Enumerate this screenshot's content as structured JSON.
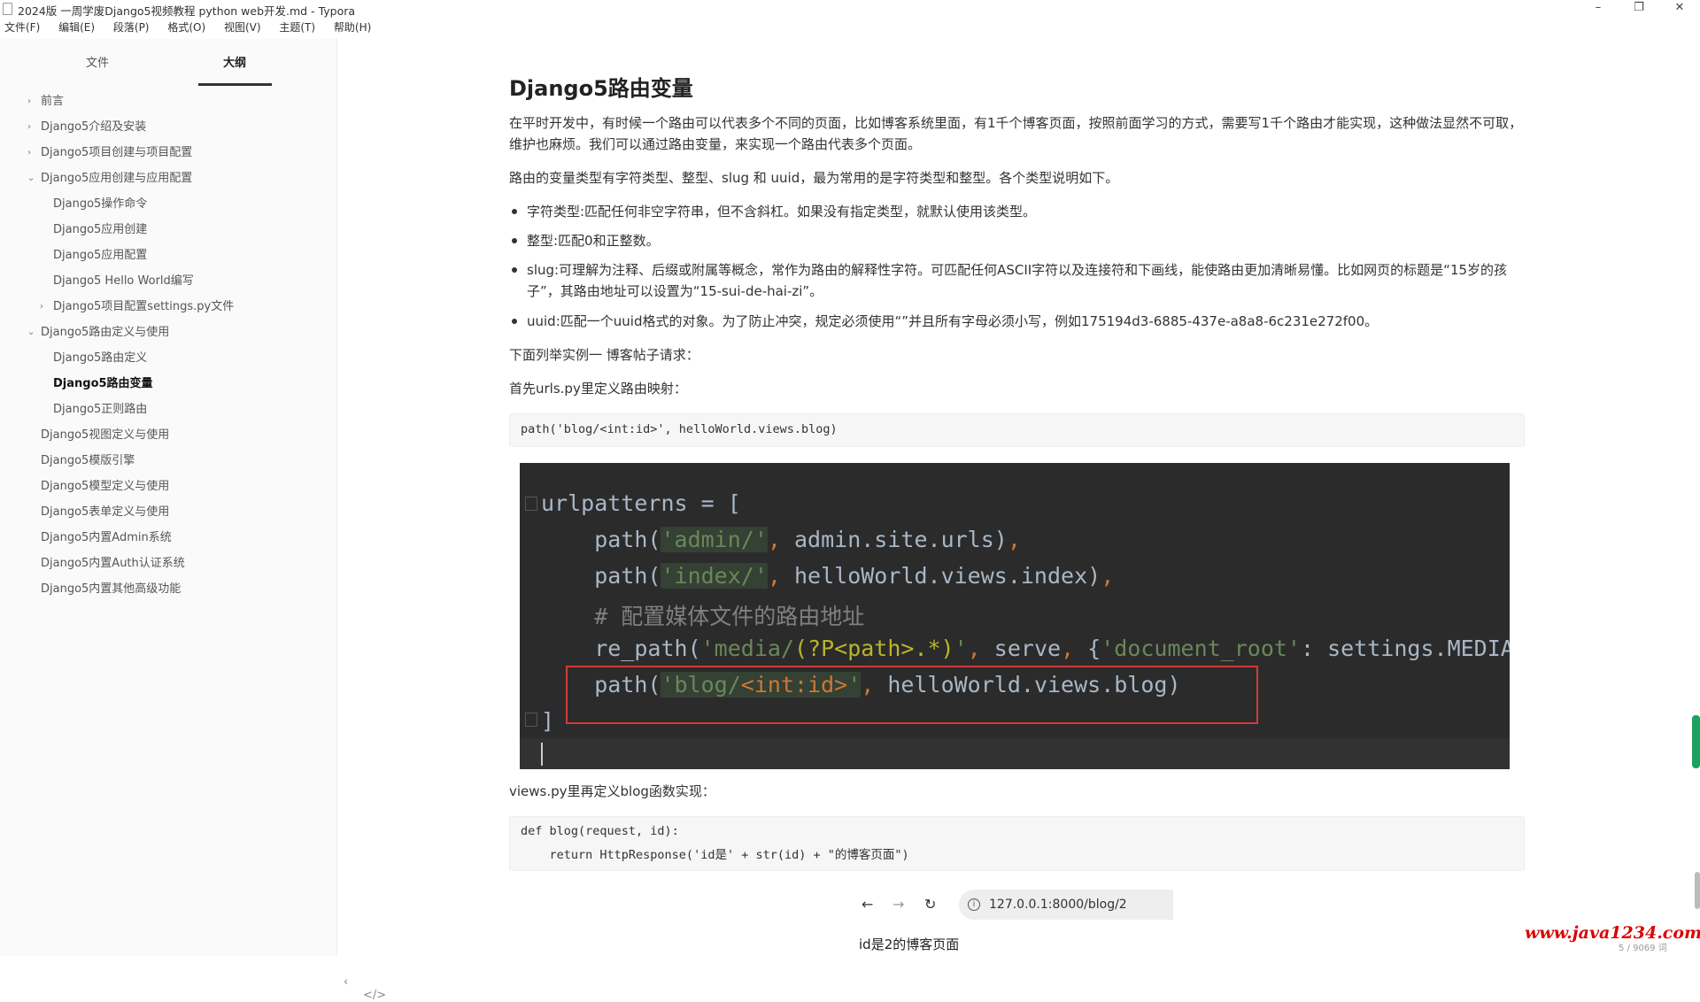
{
  "window": {
    "title": "2024版 一周学废Django5视频教程 python web开发.md - Typora",
    "controls": {
      "minimize": "–",
      "maximize": "❐",
      "close": "✕"
    }
  },
  "menu": [
    "文件(F)",
    "编辑(E)",
    "段落(P)",
    "格式(O)",
    "视图(V)",
    "主题(T)",
    "帮助(H)"
  ],
  "sidebar": {
    "tabs": {
      "files": "文件",
      "outline": "大纲"
    },
    "outline": [
      {
        "label": "前言",
        "level": 1,
        "toggle": "›"
      },
      {
        "label": "Django5介绍及安装",
        "level": 1,
        "toggle": "›"
      },
      {
        "label": "Django5项目创建与项目配置",
        "level": 1,
        "toggle": "›"
      },
      {
        "label": "Django5应用创建与应用配置",
        "level": 1,
        "toggle": "⌄"
      },
      {
        "label": "Django5操作命令",
        "level": 2,
        "toggle": ""
      },
      {
        "label": "Django5应用创建",
        "level": 2,
        "toggle": ""
      },
      {
        "label": "Django5应用配置",
        "level": 2,
        "toggle": ""
      },
      {
        "label": "Django5 Hello World编写",
        "level": 2,
        "toggle": ""
      },
      {
        "label": "Django5项目配置settings.py文件",
        "level": 2,
        "toggle": "›"
      },
      {
        "label": "Django5路由定义与使用",
        "level": 1,
        "toggle": "⌄"
      },
      {
        "label": "Django5路由定义",
        "level": 2,
        "toggle": ""
      },
      {
        "label": "Django5路由变量",
        "level": 2,
        "toggle": "",
        "active": true
      },
      {
        "label": "Django5正则路由",
        "level": 2,
        "toggle": ""
      },
      {
        "label": "Django5视图定义与使用",
        "level": 1,
        "toggle": ""
      },
      {
        "label": "Django5模版引擎",
        "level": 1,
        "toggle": ""
      },
      {
        "label": "Django5模型定义与使用",
        "level": 1,
        "toggle": ""
      },
      {
        "label": "Django5表单定义与使用",
        "level": 1,
        "toggle": ""
      },
      {
        "label": "Django5内置Admin系统",
        "level": 1,
        "toggle": ""
      },
      {
        "label": "Django5内置Auth认证系统",
        "level": 1,
        "toggle": ""
      },
      {
        "label": "Django5内置其他高级功能",
        "level": 1,
        "toggle": ""
      }
    ],
    "bottom_icons": {
      "collapse": "‹",
      "source": "</>"
    }
  },
  "content": {
    "heading": "Django5路由变量",
    "intro": "在平时开发中，有时候一个路由可以代表多个不同的页面，比如博客系统里面，有1千个博客页面，按照前面学习的方式，需要写1千个路由才能实现，这种做法显然不可取，维护也麻烦。我们可以通过路由变量，来实现一个路由代表多个页面。",
    "types_intro": "路由的变量类型有字符类型、整型、slug 和 uuid，最为常用的是字符类型和整型。各个类型说明如下。",
    "bullets": [
      "字符类型:匹配任何非空字符串，但不含斜杠。如果没有指定类型，就默认使用该类型。",
      "整型:匹配0和正整数。",
      "slug:可理解为注释、后缀或附属等概念，常作为路由的解释性字符。可匹配任何ASCII字符以及连接符和下画线，能使路由更加清晰易懂。比如网页的标题是“15岁的孩子”，其路由地址可以设置为“15-sui-de-hai-zi”。",
      "uuid:匹配一个uuid格式的对象。为了防止冲突，规定必须使用“”并且所有字母必须小写，例如175194d3-6885-437e-a8a8-6c231e272f00。"
    ],
    "example_intro": "下面列举实例一 博客帖子请求：",
    "urls_intro": "首先urls.py里定义路由映射：",
    "code1": "path('blog/<int:id>', helloWorld.views.blog)",
    "views_intro": "views.py里再定义blog函数实现：",
    "code2_line1": "def blog(request, id):",
    "code2_line2": "    return HttpResponse('id是' + str(id) + \"的博客页面\")"
  },
  "ide": {
    "l1": "urlpatterns = [",
    "l2_a": "    path(",
    "l2_b": "'admin/'",
    "l2_c": ",",
    "l2_d": " admin.site.urls)",
    "l2_e": ",",
    "l3_a": "    path(",
    "l3_b": "'index/'",
    "l3_c": ",",
    "l3_d": " helloWorld.views.index)",
    "l3_e": ",",
    "l4": "    # 配置媒体文件的路由地址",
    "l5_a": "    re_path(",
    "l5_b": "'media/",
    "l5_c": "(?P<path>.*)",
    "l5_d": "'",
    "l5_e": ",",
    "l5_f": " serve",
    "l5_g": ",",
    "l5_h": " {",
    "l5_i": "'document_root'",
    "l5_j": ": settings.MEDIA",
    "l6_a": "    path(",
    "l6_b": "'blog/",
    "l6_c": "<int:id>",
    "l6_d": "'",
    "l6_e": ",",
    "l6_f": " helloWorld.views.blog)",
    "l7": "]"
  },
  "browser": {
    "back": "←",
    "forward": "→",
    "reload": "↻",
    "info": "i",
    "url": "127.0.0.1:8000/blog/2",
    "result": "id是2的博客页面"
  },
  "watermark": "www.java1234.com",
  "wordcount": "5 / 9069 词"
}
